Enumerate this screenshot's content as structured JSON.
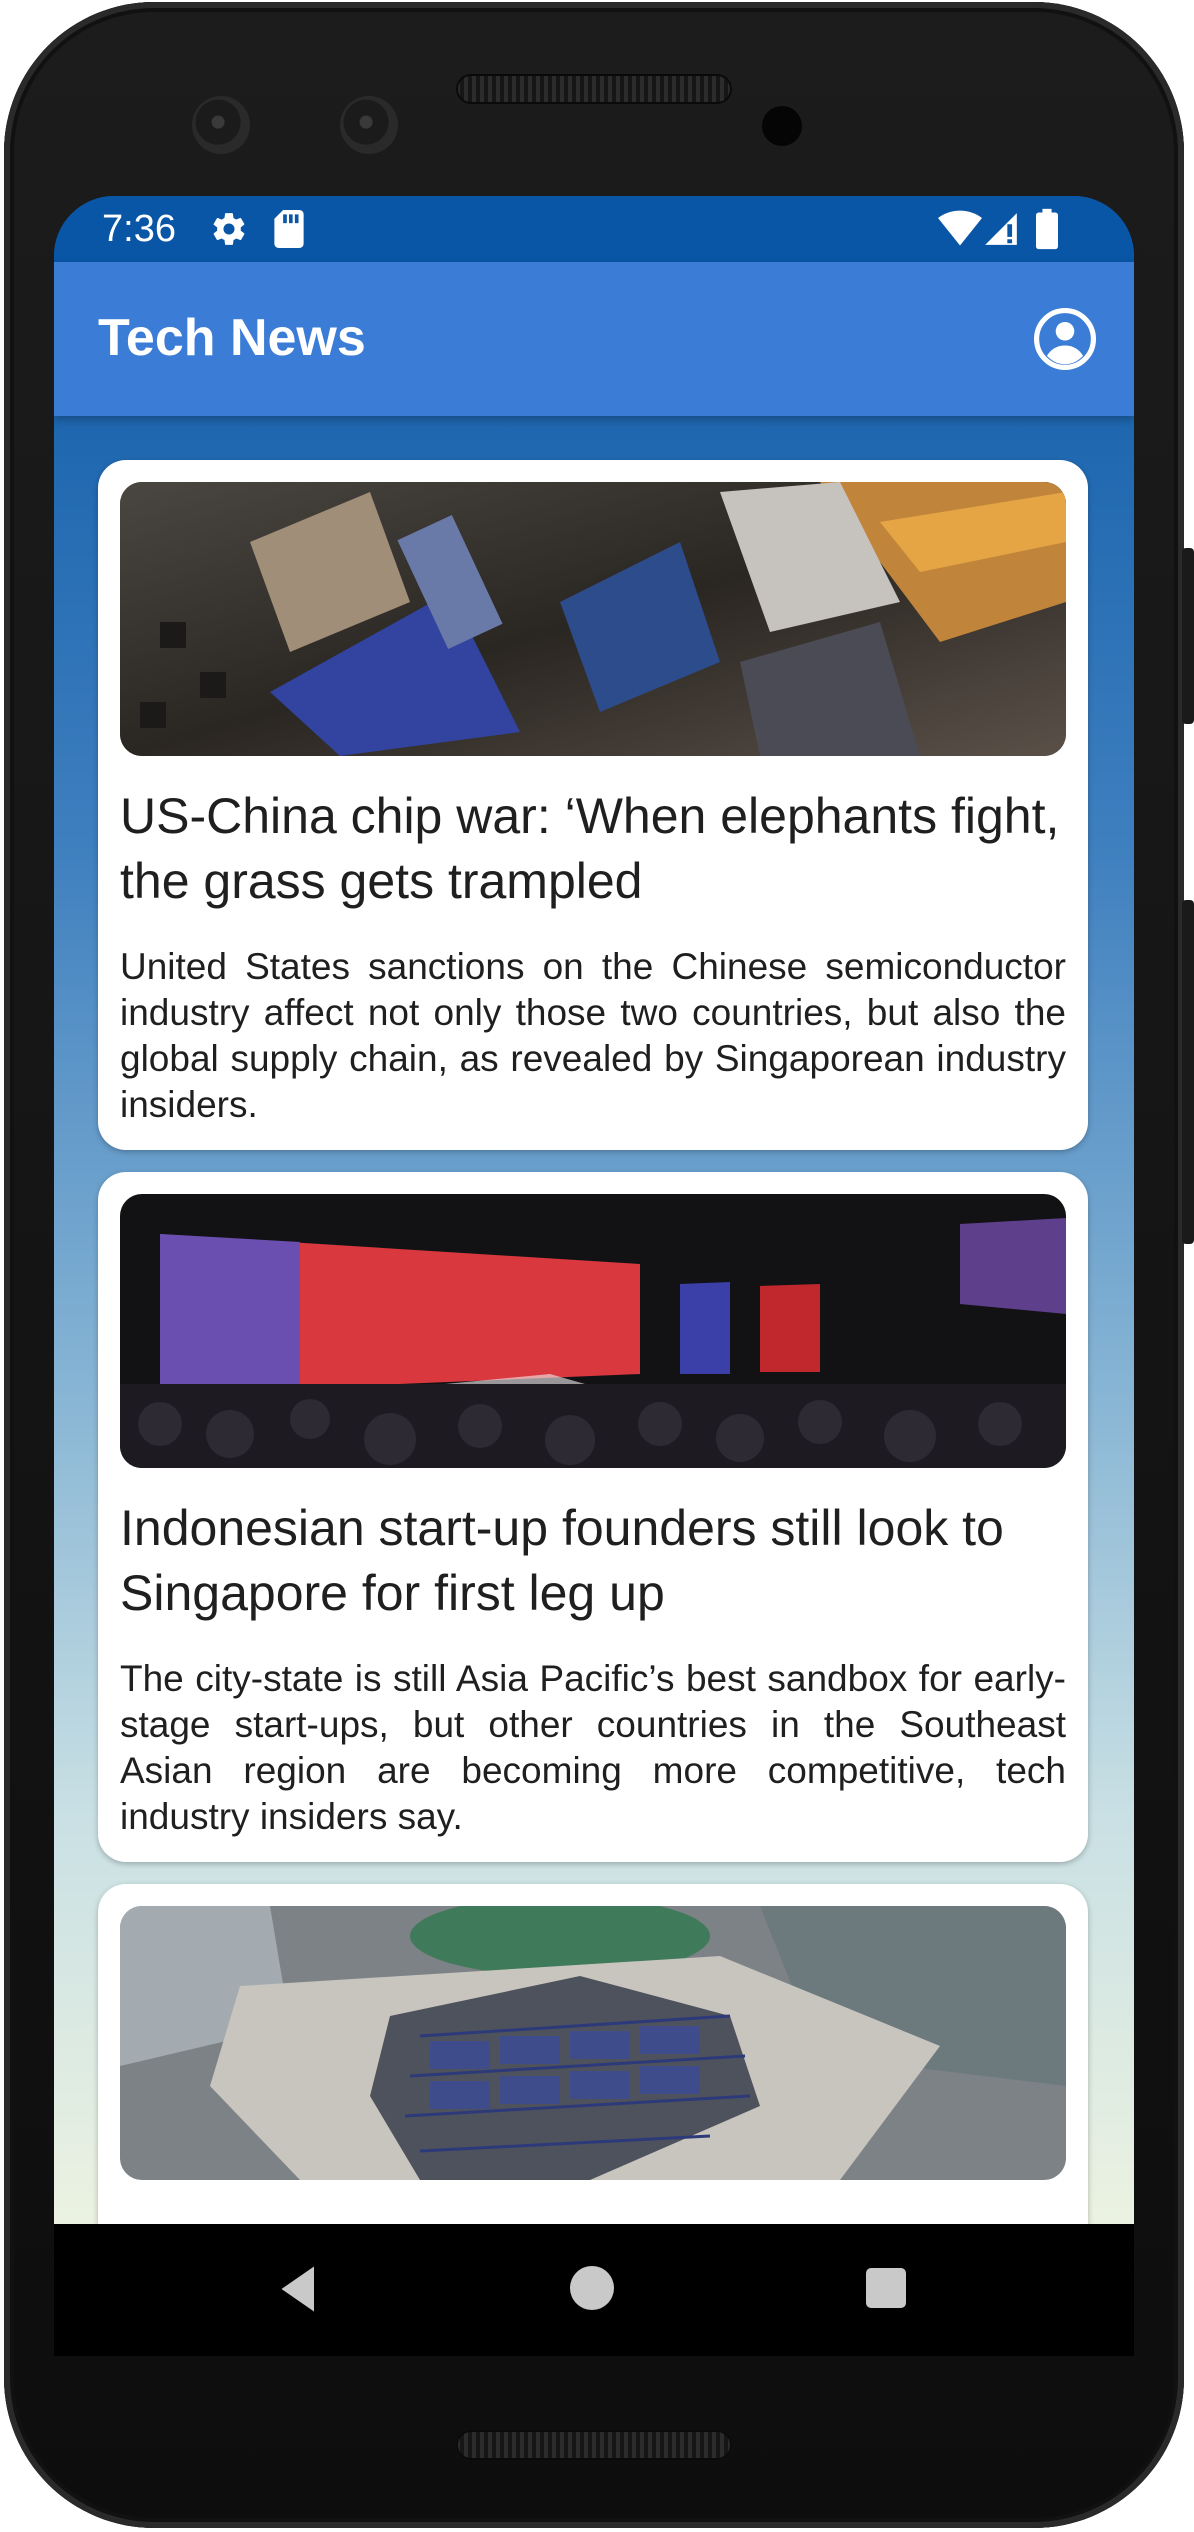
{
  "status_bar": {
    "time": "7:36",
    "icons": [
      "gear-icon",
      "sd-card-icon",
      "wifi-icon",
      "signal-icon",
      "battery-icon"
    ]
  },
  "app_bar": {
    "title": "Tech News",
    "account_icon": "account-circle-icon",
    "color": "#3a7cd6"
  },
  "articles": [
    {
      "headline": "US-China chip war: ‘When elephants fight, the grass gets trampled",
      "summary": "United States sanctions on the Chinese semiconductor industry affect not only those two countries, but also the global supply chain, as revealed by Singaporean industry insiders.",
      "image": "circuit-board-photo"
    },
    {
      "headline": "Indonesian start-up founders still look to Singapore for first leg up",
      "summary": "The city-state is still Asia Pacific’s best sandbox for early-stage start-ups, but other countries in the Southeast Asian region are becoming more competitive, tech industry insiders say.",
      "image": "conference-stage-photo"
    },
    {
      "headline": "",
      "summary": "",
      "image": "solar-panel-rooftop-photo"
    }
  ],
  "nav_bar": {
    "icons": [
      "back-icon",
      "home-icon",
      "recents-icon"
    ]
  },
  "colors": {
    "status_bar": "#0955a6",
    "app_bar": "#3a7cd6",
    "card": "#ffffff",
    "text": "#1f1f1f"
  }
}
